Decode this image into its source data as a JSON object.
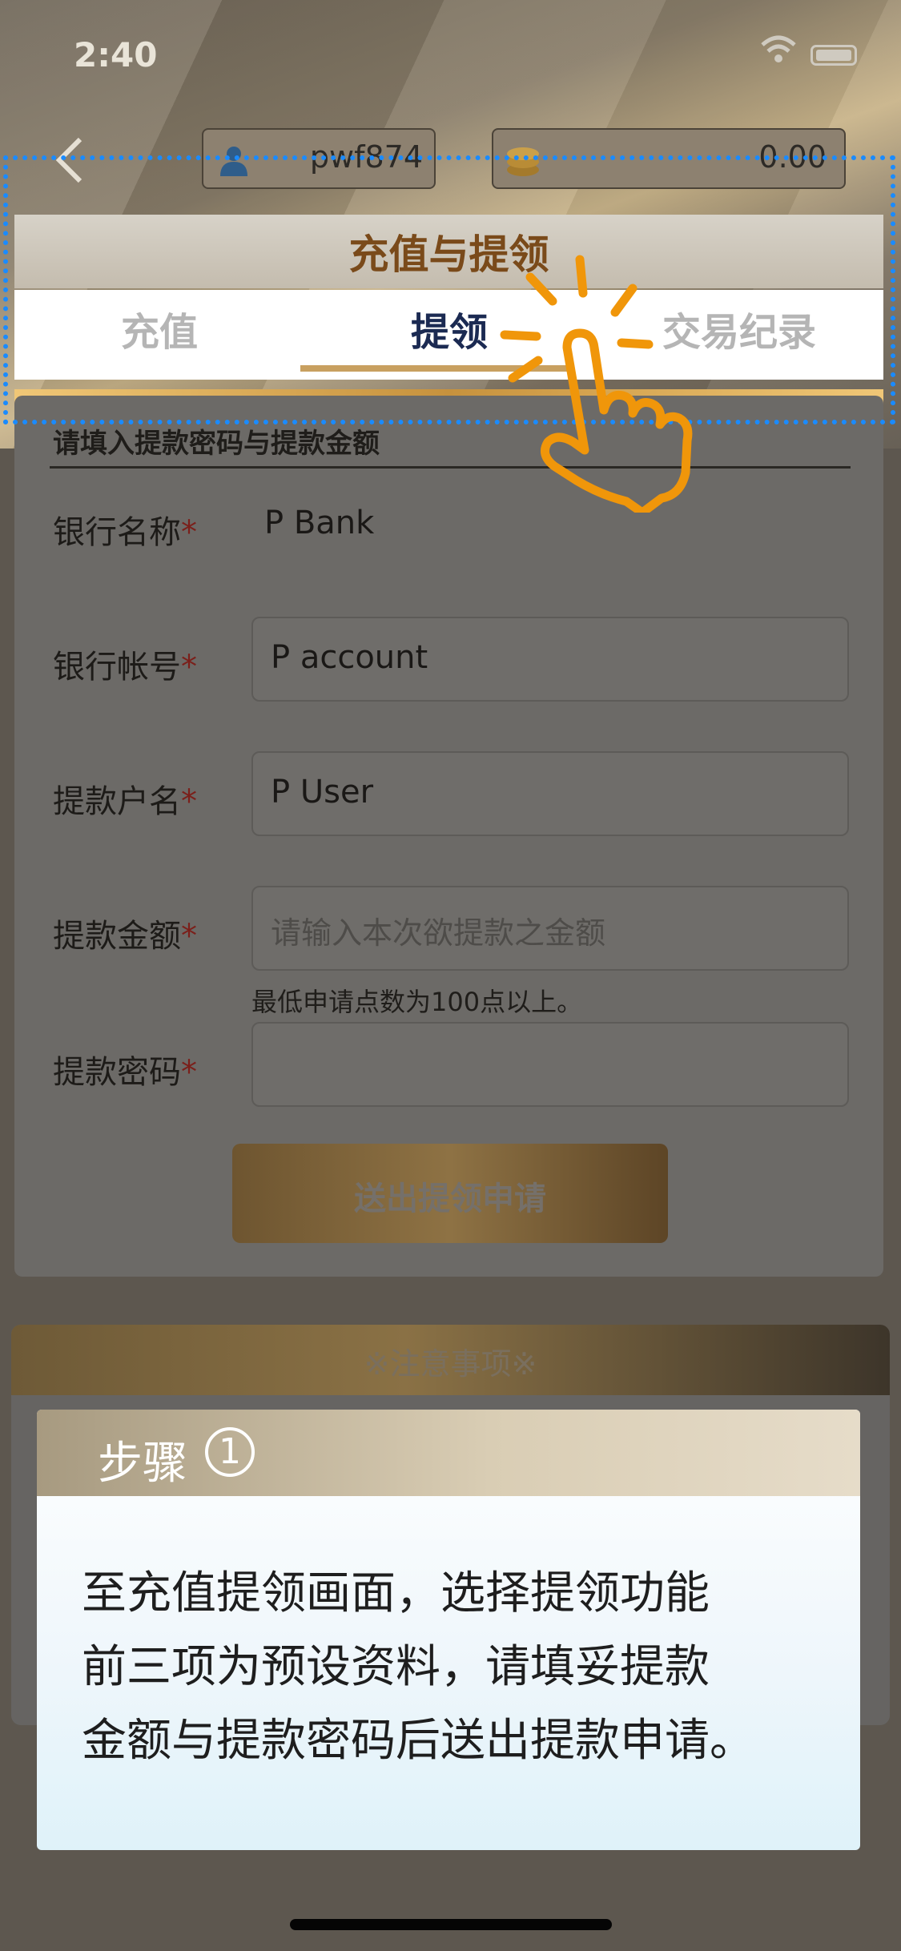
{
  "status_bar": {
    "time": "2:40"
  },
  "header": {
    "username": "pwf874",
    "balance": "0.00",
    "title": "充值与提领"
  },
  "tabs": [
    {
      "label": "充值",
      "active": false
    },
    {
      "label": "提领",
      "active": true
    },
    {
      "label": "交易纪录",
      "active": false
    }
  ],
  "form": {
    "instruction": "请填入提款密码与提款金额",
    "fields": [
      {
        "label": "银行名称",
        "required_mark": "*",
        "value": "P Bank",
        "placeholder": ""
      },
      {
        "label": "银行帐号",
        "required_mark": "*",
        "value": "P account",
        "placeholder": ""
      },
      {
        "label": "提款户名",
        "required_mark": "*",
        "value": "P User",
        "placeholder": ""
      },
      {
        "label": "提款金额",
        "required_mark": "*",
        "value": "",
        "placeholder": "请输入本次欲提款之金额"
      },
      {
        "label": "提款密码",
        "required_mark": "*",
        "value": "",
        "placeholder": ""
      }
    ],
    "amount_hint": "最低申请点数为100点以上。",
    "submit_label": "送出提领申请"
  },
  "notice": {
    "title": "※注意事项※"
  },
  "step_popup": {
    "title": "步骤",
    "number": "1",
    "lines": [
      "至充值提领画面，选择提领功能",
      "前三项为预设资料，请填妥提款",
      "金额与提款密码后送出提款申请。"
    ]
  },
  "colors": {
    "active_tab": "#1b2a52",
    "accent_gold": "#c8a060",
    "highlight": "#1a8bff",
    "pointer": "#f0960a"
  },
  "icons": [
    "back-icon",
    "user-icon",
    "coins-icon",
    "wifi-icon",
    "battery-icon",
    "hand-pointer-icon"
  ]
}
